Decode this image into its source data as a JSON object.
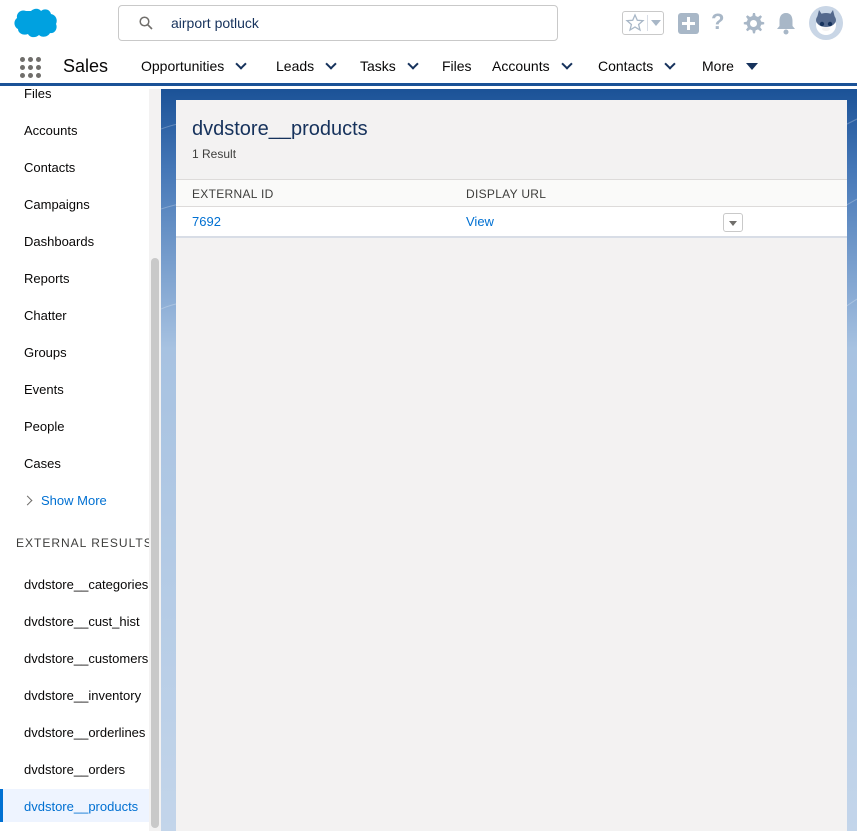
{
  "header": {
    "search_value": "airport potluck"
  },
  "nav": {
    "app_name": "Sales",
    "items": [
      {
        "label": "Opportunities",
        "dropdown": true
      },
      {
        "label": "Leads",
        "dropdown": true
      },
      {
        "label": "Tasks",
        "dropdown": true
      },
      {
        "label": "Files",
        "dropdown": false
      },
      {
        "label": "Accounts",
        "dropdown": true
      },
      {
        "label": "Contacts",
        "dropdown": true
      },
      {
        "label": "More",
        "dropdown": "caret"
      }
    ]
  },
  "sidebar": {
    "items": [
      "Files",
      "Accounts",
      "Contacts",
      "Campaigns",
      "Dashboards",
      "Reports",
      "Chatter",
      "Groups",
      "Events",
      "People",
      "Cases"
    ],
    "show_more": "Show More",
    "external_title": "EXTERNAL RESULTS",
    "external_items": [
      "dvdstore__categories",
      "dvdstore__cust_hist",
      "dvdstore__customers",
      "dvdstore__inventory",
      "dvdstore__orderlines",
      "dvdstore__orders",
      "dvdstore__products"
    ],
    "active_external": "dvdstore__products"
  },
  "main": {
    "title": "dvdstore__products",
    "result_count": "1 Result",
    "columns": [
      "EXTERNAL ID",
      "DISPLAY URL"
    ],
    "rows": [
      {
        "external_id": "7692",
        "display_url": "View"
      }
    ]
  },
  "colors": {
    "brand": "#0070d2",
    "nav_border": "#1b5297",
    "link": "#0070d2"
  }
}
